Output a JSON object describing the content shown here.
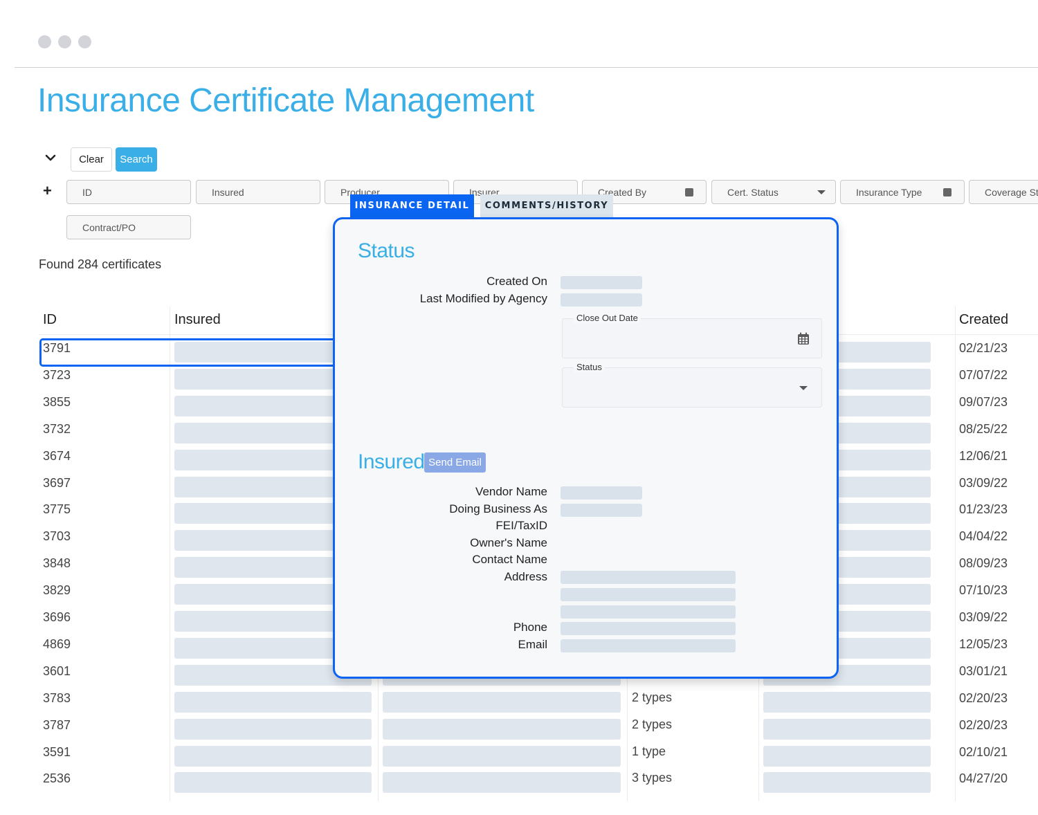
{
  "window": {
    "controls": [
      "close",
      "minimize",
      "maximize"
    ]
  },
  "page": {
    "title": "Insurance Certificate Management"
  },
  "search_bar": {
    "toggle_icon": "chevron-down-icon",
    "clear_label": "Clear",
    "search_label": "Search",
    "add_icon": "plus-icon",
    "filters": [
      {
        "name": "id",
        "placeholder": "ID",
        "type": "text"
      },
      {
        "name": "insured",
        "placeholder": "Insured",
        "type": "text"
      },
      {
        "name": "producer",
        "placeholder": "Producer",
        "type": "text"
      },
      {
        "name": "insurer",
        "placeholder": "Insurer",
        "type": "text"
      },
      {
        "name": "created-by",
        "placeholder": "Created By",
        "type": "multi-select"
      },
      {
        "name": "cert-status",
        "placeholder": "Cert. Status",
        "type": "select"
      },
      {
        "name": "insurance-type",
        "placeholder": "Insurance Type",
        "type": "multi-select"
      },
      {
        "name": "coverage-status",
        "placeholder": "Coverage St",
        "type": "text"
      },
      {
        "name": "contract-po",
        "placeholder": "Contract/PO",
        "type": "text"
      }
    ]
  },
  "results": {
    "summary": "Found 284 certificates"
  },
  "table": {
    "columns": [
      "ID",
      "Insured",
      "Created"
    ],
    "selected_row_id": "3791",
    "rows": [
      {
        "id": "3791",
        "types": "",
        "created": "02/21/23"
      },
      {
        "id": "3723",
        "types": "",
        "created": "07/07/22"
      },
      {
        "id": "3855",
        "types": "",
        "created": "09/07/23"
      },
      {
        "id": "3732",
        "types": "",
        "created": "08/25/22"
      },
      {
        "id": "3674",
        "types": "",
        "created": "12/06/21"
      },
      {
        "id": "3697",
        "types": "",
        "created": "03/09/22"
      },
      {
        "id": "3775",
        "types": "",
        "created": "01/23/23"
      },
      {
        "id": "3703",
        "types": "",
        "created": "04/04/22"
      },
      {
        "id": "3848",
        "types": "",
        "created": "08/09/23"
      },
      {
        "id": "3829",
        "types": "",
        "created": "07/10/23"
      },
      {
        "id": "3696",
        "types": "",
        "created": "03/09/22"
      },
      {
        "id": "4869",
        "types": "",
        "created": "12/05/23"
      },
      {
        "id": "3601",
        "types": "",
        "created": "03/01/21"
      },
      {
        "id": "3783",
        "types": "2 types",
        "created": "02/20/23"
      },
      {
        "id": "3787",
        "types": "2 types",
        "created": "02/20/23"
      },
      {
        "id": "3591",
        "types": "1 type",
        "created": "02/10/21"
      },
      {
        "id": "2536",
        "types": "3 types",
        "created": "04/27/20"
      }
    ]
  },
  "detail_panel": {
    "tabs": [
      {
        "label": "INSURANCE DETAIL",
        "active": true
      },
      {
        "label": "COMMENTS/HISTORY",
        "active": false
      }
    ],
    "status_section": {
      "heading": "Status",
      "fields": [
        {
          "label": "Created On",
          "value": ""
        },
        {
          "label": "Last Modified by Agency",
          "value": ""
        }
      ],
      "close_out_date": {
        "label": "Close Out Date",
        "value": "",
        "icon": "calendar-icon"
      },
      "status_select": {
        "label": "Status",
        "value": ""
      }
    },
    "insured_section": {
      "heading": "Insured",
      "send_email_label": "Send Email",
      "fields": [
        {
          "label": "Vendor Name",
          "value": ""
        },
        {
          "label": "Doing Business As",
          "value": ""
        },
        {
          "label": "FEI/TaxID",
          "value": ""
        },
        {
          "label": "Owner's Name",
          "value": ""
        },
        {
          "label": "Contact Name",
          "value": ""
        },
        {
          "label": "Address",
          "value": ""
        },
        {
          "label": "Phone",
          "value": ""
        },
        {
          "label": "Email",
          "value": ""
        }
      ]
    }
  },
  "colors": {
    "accent": "#3aaee6",
    "selection": "#0d63f2",
    "active_tab": "#0a66f2",
    "placeholder_bar": "#dfe6ee",
    "send_email": "#8aa7e6"
  }
}
